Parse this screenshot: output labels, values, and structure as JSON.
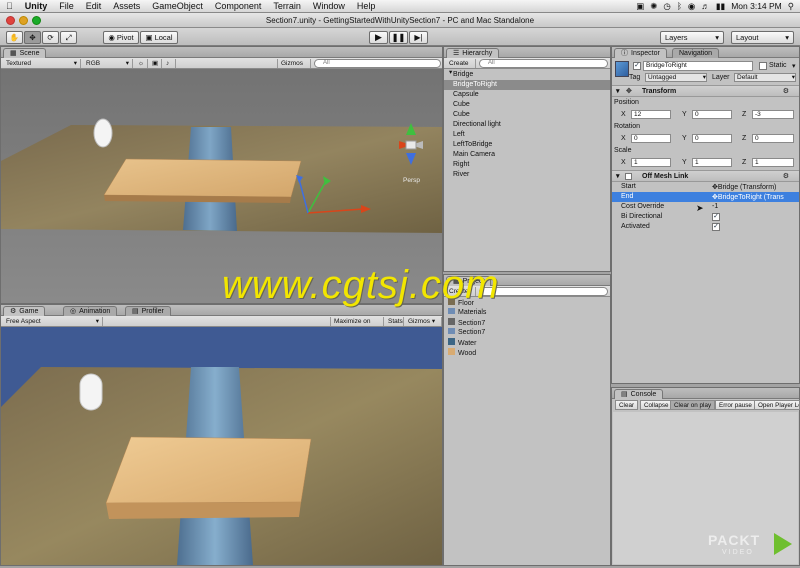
{
  "menubar": {
    "app": "Unity",
    "items": [
      "File",
      "Edit",
      "Assets",
      "GameObject",
      "Component",
      "Terrain",
      "Window",
      "Help"
    ],
    "clock": "Mon 3:14 PM"
  },
  "window": {
    "title": "Section7.unity - GettingStartedWithUnitySection7 - PC and Mac Standalone"
  },
  "toolbar": {
    "pivot_label": "Pivot",
    "local_label": "Local",
    "layers_label": "Layers",
    "layout_label": "Layout"
  },
  "scene": {
    "tab_label": "Scene",
    "render_mode": "Textured",
    "color_mode": "RGB",
    "gizmos_label": "Gizmos",
    "search_placeholder": "All",
    "persp_label": "Persp"
  },
  "game": {
    "tab_label": "Game",
    "animation_tab": "Animation",
    "profiler_tab": "Profiler",
    "aspect": "Free Aspect",
    "maximize_label": "Maximize on Play",
    "stats_label": "Stats",
    "gizmos_label": "Gizmos"
  },
  "hierarchy": {
    "tab_label": "Hierarchy",
    "create_label": "Create",
    "search_placeholder": "All",
    "items": [
      "Bridge",
      "BridgeToRight",
      "Capsule",
      "Cube",
      "Cube",
      "Directional light",
      "Left",
      "LeftToBridge",
      "Main Camera",
      "Right",
      "River"
    ],
    "selected_index": 1
  },
  "project": {
    "tab_label": "Project",
    "create_label": "Create",
    "items": [
      "Floor",
      "Materials",
      "Section7",
      "Section7",
      "Water",
      "Wood"
    ]
  },
  "inspector": {
    "tab_label": "Inspector",
    "navigation_tab": "Navigation",
    "object_name": "BridgeToRight",
    "static_label": "Static",
    "tag_label": "Tag",
    "tag_value": "Untagged",
    "layer_label": "Layer",
    "layer_value": "Default",
    "transform": {
      "title": "Transform",
      "position_label": "Position",
      "position": {
        "x": "12",
        "y": "0",
        "z": "-3"
      },
      "rotation_label": "Rotation",
      "rotation": {
        "x": "0",
        "y": "0",
        "z": "0"
      },
      "scale_label": "Scale",
      "scale": {
        "x": "1",
        "y": "1",
        "z": "1"
      }
    },
    "off_mesh_link": {
      "title": "Off Mesh Link",
      "start_label": "Start",
      "start_value": "Bridge (Transform)",
      "end_label": "End",
      "end_value": "BridgeToRight (Trans",
      "cost_label": "Cost Override",
      "cost_value": "-1",
      "bidirectional_label": "Bi Directional",
      "bidirectional": true,
      "activated_label": "Activated",
      "activated": true
    }
  },
  "console": {
    "tab_label": "Console",
    "buttons": [
      "Clear",
      "Collapse",
      "Clear on play",
      "Error pause",
      "Open Player Lo"
    ]
  },
  "watermark": "www.cgtsj.com",
  "logo": {
    "brand": "PACKT",
    "sub": "VIDEO"
  },
  "colors": {
    "accent": "#3d80df",
    "watermark": "#f2e600",
    "game_bg": "#3f5a93"
  }
}
